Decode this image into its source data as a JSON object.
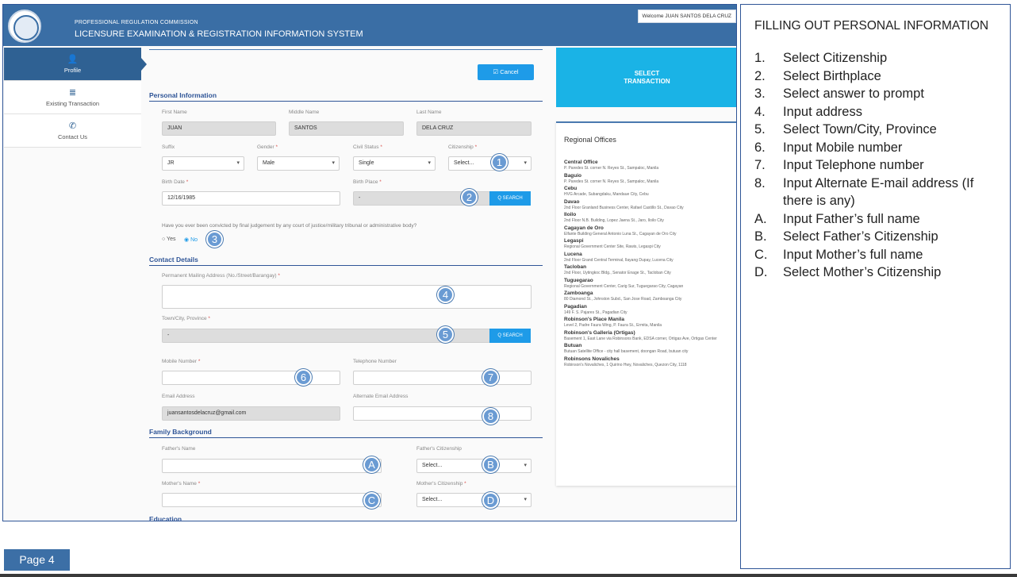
{
  "header": {
    "org_name": "PROFESSIONAL REGULATION COMMISSION",
    "system_name": "LICENSURE EXAMINATION & REGISTRATION INFORMATION SYSTEM",
    "welcome": "Welcome JUAN SANTOS DELA CRUZ"
  },
  "sidebar": {
    "items": [
      {
        "label": "Profile",
        "icon": "user-icon",
        "glyph": "👤"
      },
      {
        "label": "Existing Transaction",
        "icon": "list-icon",
        "glyph": "≣"
      },
      {
        "label": "Contact Us",
        "icon": "phone-icon",
        "glyph": "✆"
      }
    ]
  },
  "form": {
    "cancel_label": "Cancel",
    "cancel_glyph": "☑",
    "personal_title": "Personal Information",
    "first_name_label": "First Name",
    "first_name": "JUAN",
    "middle_name_label": "Middle Name",
    "middle_name": "SANTOS",
    "last_name_label": "Last Name",
    "last_name": "DELA CRUZ",
    "suffix_label": "Suffix",
    "suffix": "JR",
    "gender_label": "Gender",
    "gender": "Male",
    "civil_status_label": "Civil Status",
    "civil_status": "Single",
    "citizenship_label": "Citizenship",
    "citizenship": "Select...",
    "birth_date_label": "Birth Date",
    "birth_date": "12/16/1985",
    "birth_place_label": "Birth Place",
    "birth_place": "-",
    "search_label": "Q  SEARCH",
    "conviction_question": "Have you ever been convicted by final judgement by any court of justice/military tribunal or administrative body?",
    "yes_label": "Yes",
    "no_label": "No",
    "required_mark": "*",
    "contact_title": "Contact Details",
    "address_label": "Permanent Mailing Address (No./Street/Barangay)",
    "town_label": "Town/City, Province",
    "town": "-",
    "mobile_label": "Mobile Number",
    "telephone_label": "Telephone Number",
    "email_label": "Email Address",
    "email": "juansantosdelacruz@gmail.com",
    "alt_email_label": "Alternate Email Address",
    "family_title": "Family Background",
    "father_name_label": "Father's Name",
    "father_citizenship_label": "Father's Citizenship",
    "father_citizenship": "Select...",
    "mother_name_label": "Mother's Name",
    "mother_citizenship_label": "Mother's Citizenship",
    "mother_citizenship": "Select...",
    "education_title": "Education"
  },
  "badges": [
    "1",
    "2",
    "3",
    "4",
    "5",
    "6",
    "7",
    "8",
    "A",
    "B",
    "C",
    "D"
  ],
  "right_panel": {
    "select_transaction_line1": "SELECT",
    "select_transaction_line2": "TRANSACTION",
    "regional_title": "Regional Offices",
    "offices": [
      {
        "name": "Central Office",
        "address": "P. Paredes St. corner N. Reyes St., Sampaloc, Manila"
      },
      {
        "name": "Baguio",
        "address": "P. Paredes St. corner N. Reyes St., Sampaloc, Manila"
      },
      {
        "name": "Cebu",
        "address": "HVG Arcade, Subangdaku, Mandaue City, Cebu"
      },
      {
        "name": "Davao",
        "address": "2nd Floor Granland Business Center, Rafael Castillo St., Davao City"
      },
      {
        "name": "Iloilo",
        "address": "2nd Floor N.B. Building, Lopez Jaena St., Jaro, Iloilo City"
      },
      {
        "name": "Cagayan de Oro",
        "address": "Elfante Building General Antonio Luna St., Cagayan de Oro City"
      },
      {
        "name": "Legaspi",
        "address": "Regional Government Center Site, Rawis, Legaspi City"
      },
      {
        "name": "Lucena",
        "address": "2nd Floor Grand Central Terminal, Ilayang Dupay, Lucena City"
      },
      {
        "name": "Tacloban",
        "address": "2nd Floor, Uytingkoc Bldg., Senator Enage St., Tacloban City"
      },
      {
        "name": "Tuguegarao",
        "address": "Regional Government Center, Carig Sur, Tuguegarao City, Cagayan"
      },
      {
        "name": "Zamboanga",
        "address": "80 Diamond St., Johnston Subd., San Jose Road, Zamboanga City"
      },
      {
        "name": "Pagadian",
        "address": "149 F. S. Pajares St., Pagadian City"
      },
      {
        "name": "Robinson's Place Manila",
        "address": "Level 2, Padre Faura Wing, P. Faura St., Ermita, Manila"
      },
      {
        "name": "Robinson's Galleria (Ortigas)",
        "address": "Basement 1, East Lane via Robinsons Bank, EDSA corner, Ortigas Ave, Ortigas Center"
      },
      {
        "name": "Butuan",
        "address": "Butuan Satellite Office - city hall basement, doongan Road, butuan city"
      },
      {
        "name": "Robinsons Novaliches",
        "address": "Robinson's Novaliches, 1 Quirino Hwy, Novaliches, Quezon City, 1118"
      }
    ]
  },
  "instructions": {
    "title": "FILLING OUT PERSONAL INFORMATION",
    "steps": [
      {
        "marker": "1.",
        "text": "Select Citizenship"
      },
      {
        "marker": "2.",
        "text": "Select Birthplace"
      },
      {
        "marker": "3.",
        "text": "Select answer to prompt"
      },
      {
        "marker": "4.",
        "text": "Input address"
      },
      {
        "marker": "5.",
        "text": "Select Town/City, Province"
      },
      {
        "marker": "6.",
        "text": "Input Mobile number"
      },
      {
        "marker": "7.",
        "text": "Input Telephone number"
      },
      {
        "marker": "8.",
        "text": "Input Alternate E-mail address (If there is any)"
      },
      {
        "marker": "A.",
        "text": "Input Father’s full name"
      },
      {
        "marker": "B.",
        "text": "Select Father’s Citizenship"
      },
      {
        "marker": "C.",
        "text": "Input Mother’s full name"
      },
      {
        "marker": "D.",
        "text": "Select Mother’s Citizenship"
      }
    ]
  },
  "page_label": "Page 4",
  "colors": {
    "header": "#3a6ea5",
    "accent": "#1e9be8",
    "select_transaction": "#1ab3e6",
    "badge": "#6a9bd3"
  }
}
